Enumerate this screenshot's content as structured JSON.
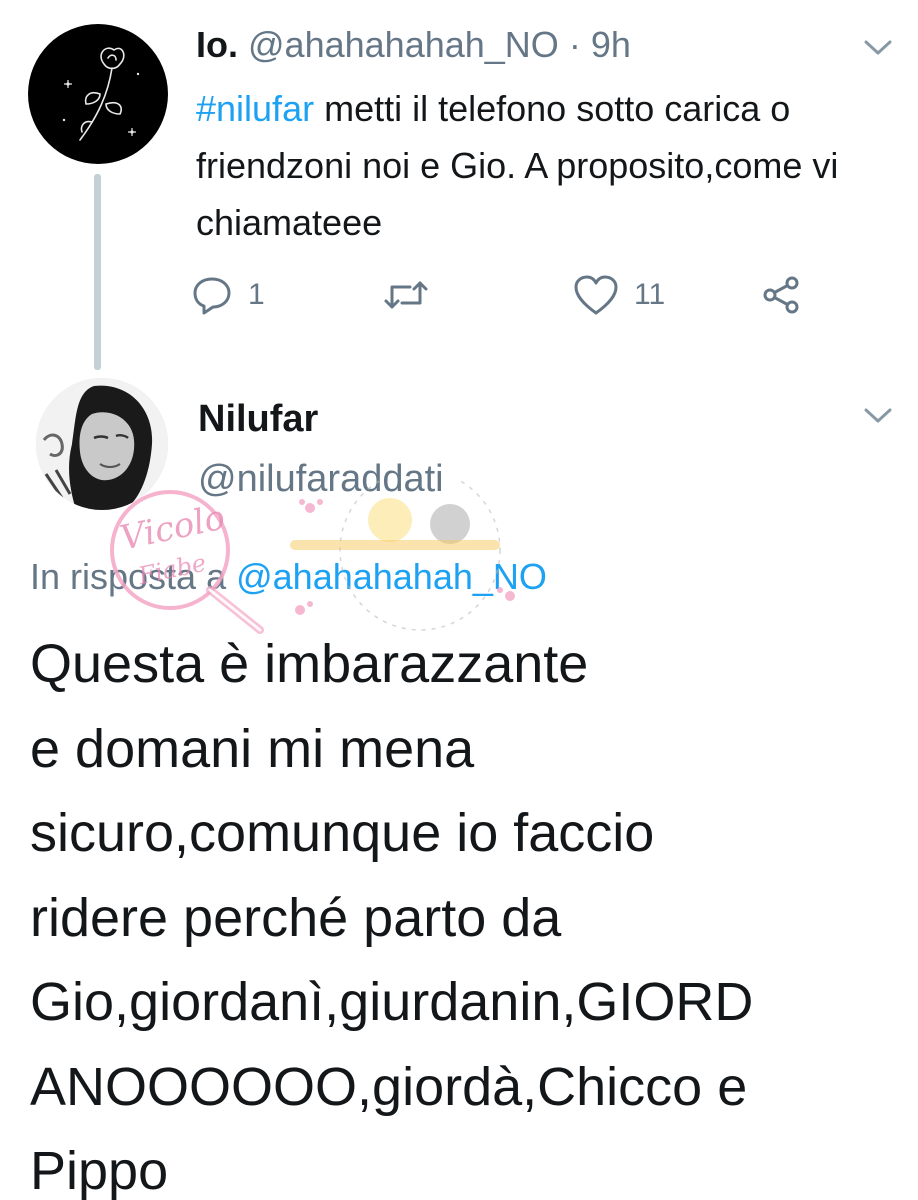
{
  "tweet1": {
    "name": "Io.",
    "handle": "@ahahahahah_NO",
    "separator": "·",
    "time": "9h",
    "hashtag": "#nilufar",
    "text": " metti il telefono sotto carica o friendzoni noi e Gio. A proposito,come vi chiamateee",
    "actions": {
      "reply_count": "1",
      "like_count": "11"
    }
  },
  "tweet2": {
    "name": "Nilufar",
    "handle": "@nilufaraddati",
    "reply_prefix": "In risposta a ",
    "reply_to": "@ahahahahah_NO",
    "text": "Questa è imbarazzante\ne domani mi mena\nsicuro,comunque io faccio\nridere perché parto da\nGio,giordanì,giurdanin,GIORD\nANOOOOOO,giordà,Chicco e\nPippo"
  },
  "watermark": {
    "text": "Vicolo delle Fiabe"
  },
  "colors": {
    "link": "#1da1f2",
    "secondary_text": "#657786",
    "primary_text": "#14171a",
    "thread_line": "#c4cfd6"
  },
  "icons": [
    "rose-icon",
    "chevron-down-icon",
    "reply-icon",
    "retweet-icon",
    "like-icon",
    "share-icon"
  ]
}
